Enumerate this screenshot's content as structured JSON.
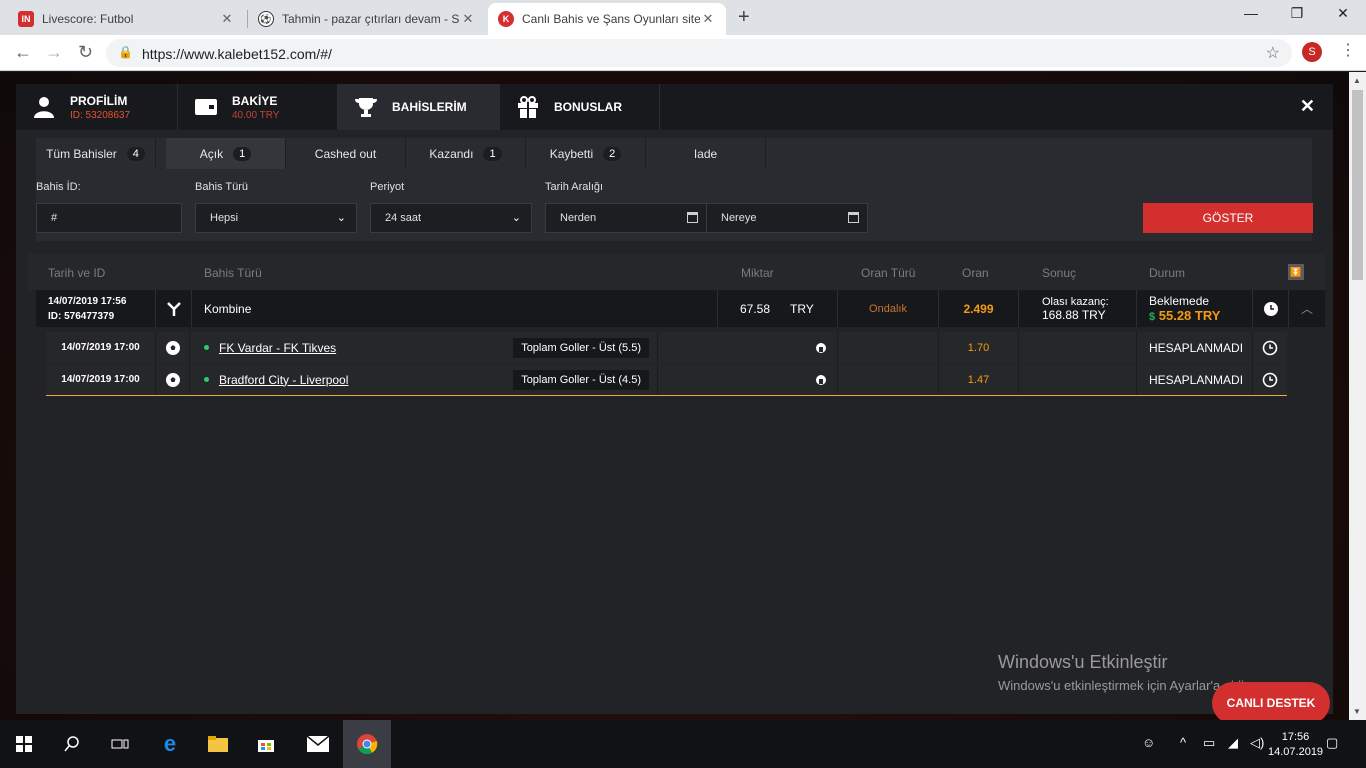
{
  "browser": {
    "tabs": [
      {
        "title": "Livescore: Futbol",
        "favicon": "IN",
        "favicon_color": "#d32f2f"
      },
      {
        "title": "Tahmin - pazar çıtırları devam - S",
        "favicon": "soccer-ball-icon"
      },
      {
        "title": "Canlı Bahis ve Şans Oyunları sitesi",
        "favicon": "K",
        "favicon_color": "#d32f2f"
      }
    ],
    "url": "https://www.kalebet152.com/#/",
    "profile_initial": "S"
  },
  "nav": {
    "profile": {
      "title": "PROFİLİM",
      "sub": "ID: 53208637"
    },
    "balance": {
      "title": "BAKİYE",
      "sub": "40.00 TRY"
    },
    "bets": {
      "title": "BAHİSLERİM"
    },
    "bonuses": {
      "title": "BONUSLAR"
    },
    "close": "✕"
  },
  "filter_tabs": [
    {
      "label": "Tüm Bahisler",
      "count": "4"
    },
    {
      "label": "Açık",
      "count": "1"
    },
    {
      "label": "Cashed out",
      "count": ""
    },
    {
      "label": "Kazandı",
      "count": "1"
    },
    {
      "label": "Kaybetti",
      "count": "2"
    },
    {
      "label": "Iade",
      "count": ""
    }
  ],
  "filters": {
    "bet_id_label": "Bahis İD:",
    "bet_id_value": "#",
    "bet_type_label": "Bahis Türü",
    "bet_type_value": "Hepsi",
    "period_label": "Periyot",
    "period_value": "24 saat",
    "date_range_label": "Tarih Aralığı",
    "date_from": "Nerden",
    "date_to": "Nereye",
    "show_button": "GÖSTER"
  },
  "table": {
    "headers": [
      "Tarih ve ID",
      "Bahis Türü",
      "Miktar",
      "Oran Türü",
      "Oran",
      "Sonuç",
      "Durum"
    ],
    "main": {
      "date": "14/07/2019 17:56",
      "id": "ID: 576477379",
      "type": "Kombine",
      "amount": "67.58",
      "currency": "TRY",
      "odds_type": "Ondalık",
      "odds": "2.499",
      "result_label": "Olası kazanç:",
      "result_value": "168.88 TRY",
      "status": "Beklemede",
      "status_amount": "55.28 TRY"
    },
    "selections": [
      {
        "date": "14/07/2019 17:00",
        "match": "FK Vardar - FK Tikves",
        "market": "Toplam Goller - Üst (5.5)",
        "odds": "1.70",
        "status": "HESAPLANMADI"
      },
      {
        "date": "14/07/2019 17:00",
        "match": "Bradford City - Liverpool",
        "market": "Toplam Goller - Üst (4.5)",
        "odds": "1.47",
        "status": "HESAPLANMADI"
      }
    ]
  },
  "watermark": {
    "line1": "Windows'u Etkinleştir",
    "line2": "Windows'u etkinleştirmek için Ayarlar'a gidin."
  },
  "support_button": "CANLI DESTEK",
  "taskbar": {
    "time": "17:56",
    "date": "14.07.2019"
  }
}
